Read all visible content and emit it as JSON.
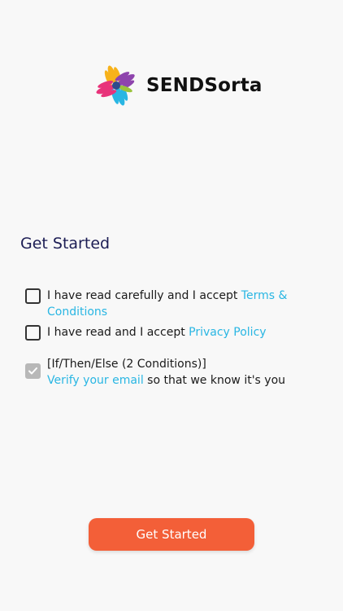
{
  "brand": {
    "name": "SENDSorta",
    "logo_icon": "hands-logo-icon",
    "colors": [
      "#f7b21b",
      "#e8337a",
      "#8e44ad",
      "#29b6e3",
      "#9bc33c"
    ]
  },
  "heading": "Get Started",
  "checkboxes": [
    {
      "prefix": "I have read carefully and I accept ",
      "link": "Terms & Conditions",
      "checked": false
    },
    {
      "prefix": "I have read and I accept ",
      "link": "Privacy Policy",
      "checked": false
    },
    {
      "line1": "[If/Then/Else (2 Conditions)]",
      "link": "Verify your email",
      "suffix": " so that we know it's you",
      "checked": true,
      "disabled": true
    }
  ],
  "button": {
    "label": "Get Started",
    "color": "#f35f38"
  },
  "link_color": "#29b6e3"
}
